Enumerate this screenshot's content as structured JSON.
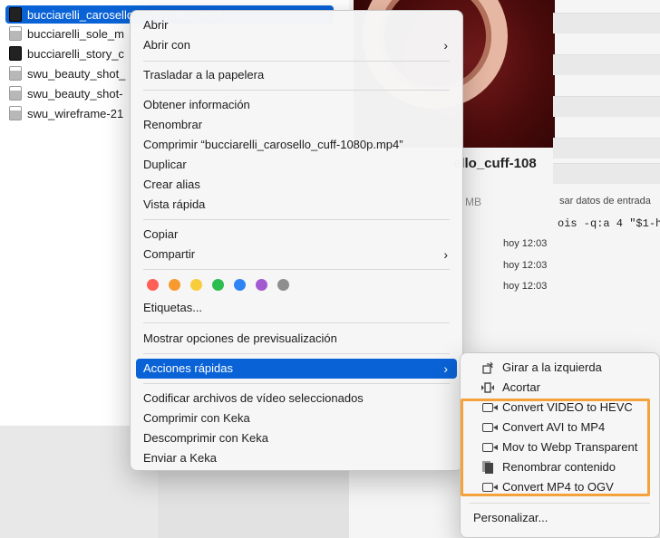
{
  "finder": {
    "files": [
      {
        "name": "bucciarelli_carosello_cuff-1080p.mp4",
        "selected": true,
        "icon": "video-thumb-icon"
      },
      {
        "name": "bucciarelli_sole_m",
        "selected": false,
        "icon": "image-thumb-icon"
      },
      {
        "name": "bucciarelli_story_c",
        "selected": false,
        "icon": "video-thumb-icon"
      },
      {
        "name": "swu_beauty_shot_",
        "selected": false,
        "icon": "image-thumb-icon"
      },
      {
        "name": "swu_beauty_shot-",
        "selected": false,
        "icon": "image-thumb-icon"
      },
      {
        "name": "swu_wireframe-21",
        "selected": false,
        "icon": "image-thumb-icon"
      }
    ]
  },
  "preview": {
    "file_name": "ello_cuff-108",
    "size": "MB",
    "script_label": "sar datos de entrada",
    "script_code": "ois -q:a 4 \"$1-h",
    "dates": [
      "hoy 12:03",
      "hoy 12:03",
      "hoy 12:03"
    ]
  },
  "menu": {
    "open": "Abrir",
    "open_with": "Abrir con",
    "trash": "Trasladar a la papelera",
    "get_info": "Obtener información",
    "rename": "Renombrar",
    "compress": "Comprimir “bucciarelli_carosello_cuff-1080p.mp4”",
    "duplicate": "Duplicar",
    "make_alias": "Crear alias",
    "quick_look": "Vista rápida",
    "copy": "Copiar",
    "share": "Compartir",
    "tags_label": "Etiquetas...",
    "tag_colors": [
      "#ff5f57",
      "#f79a2f",
      "#f8cd3b",
      "#2bbd4e",
      "#2f84f5",
      "#a35ad0",
      "#8e8e8e"
    ],
    "show_preview_options": "Mostrar opciones de previsualización",
    "quick_actions": "Acciones rápidas",
    "encode_video": "Codificar archivos de vídeo seleccionados",
    "compress_keka": "Comprimir con Keka",
    "decompress_keka": "Descomprimir con Keka",
    "send_keka": "Enviar a Keka",
    "chevron": "›"
  },
  "submenu": {
    "items": [
      {
        "label": "Girar a la izquierda",
        "icon": "rotate-left-icon"
      },
      {
        "label": "Acortar",
        "icon": "trim-icon"
      },
      {
        "label": "Convert VIDEO to HEVC",
        "icon": "video-camera-icon"
      },
      {
        "label": "Convert AVI to MP4",
        "icon": "video-camera-icon"
      },
      {
        "label": "Mov to Webp Transparent",
        "icon": "video-camera-icon"
      },
      {
        "label": "Renombrar contenido",
        "icon": "document-icon"
      },
      {
        "label": "Convert MP4 to OGV",
        "icon": "video-camera-icon"
      }
    ],
    "customize": "Personalizar..."
  },
  "colors": {
    "selection": "#0a63d6",
    "highlight_outline": "#f5a23a"
  }
}
